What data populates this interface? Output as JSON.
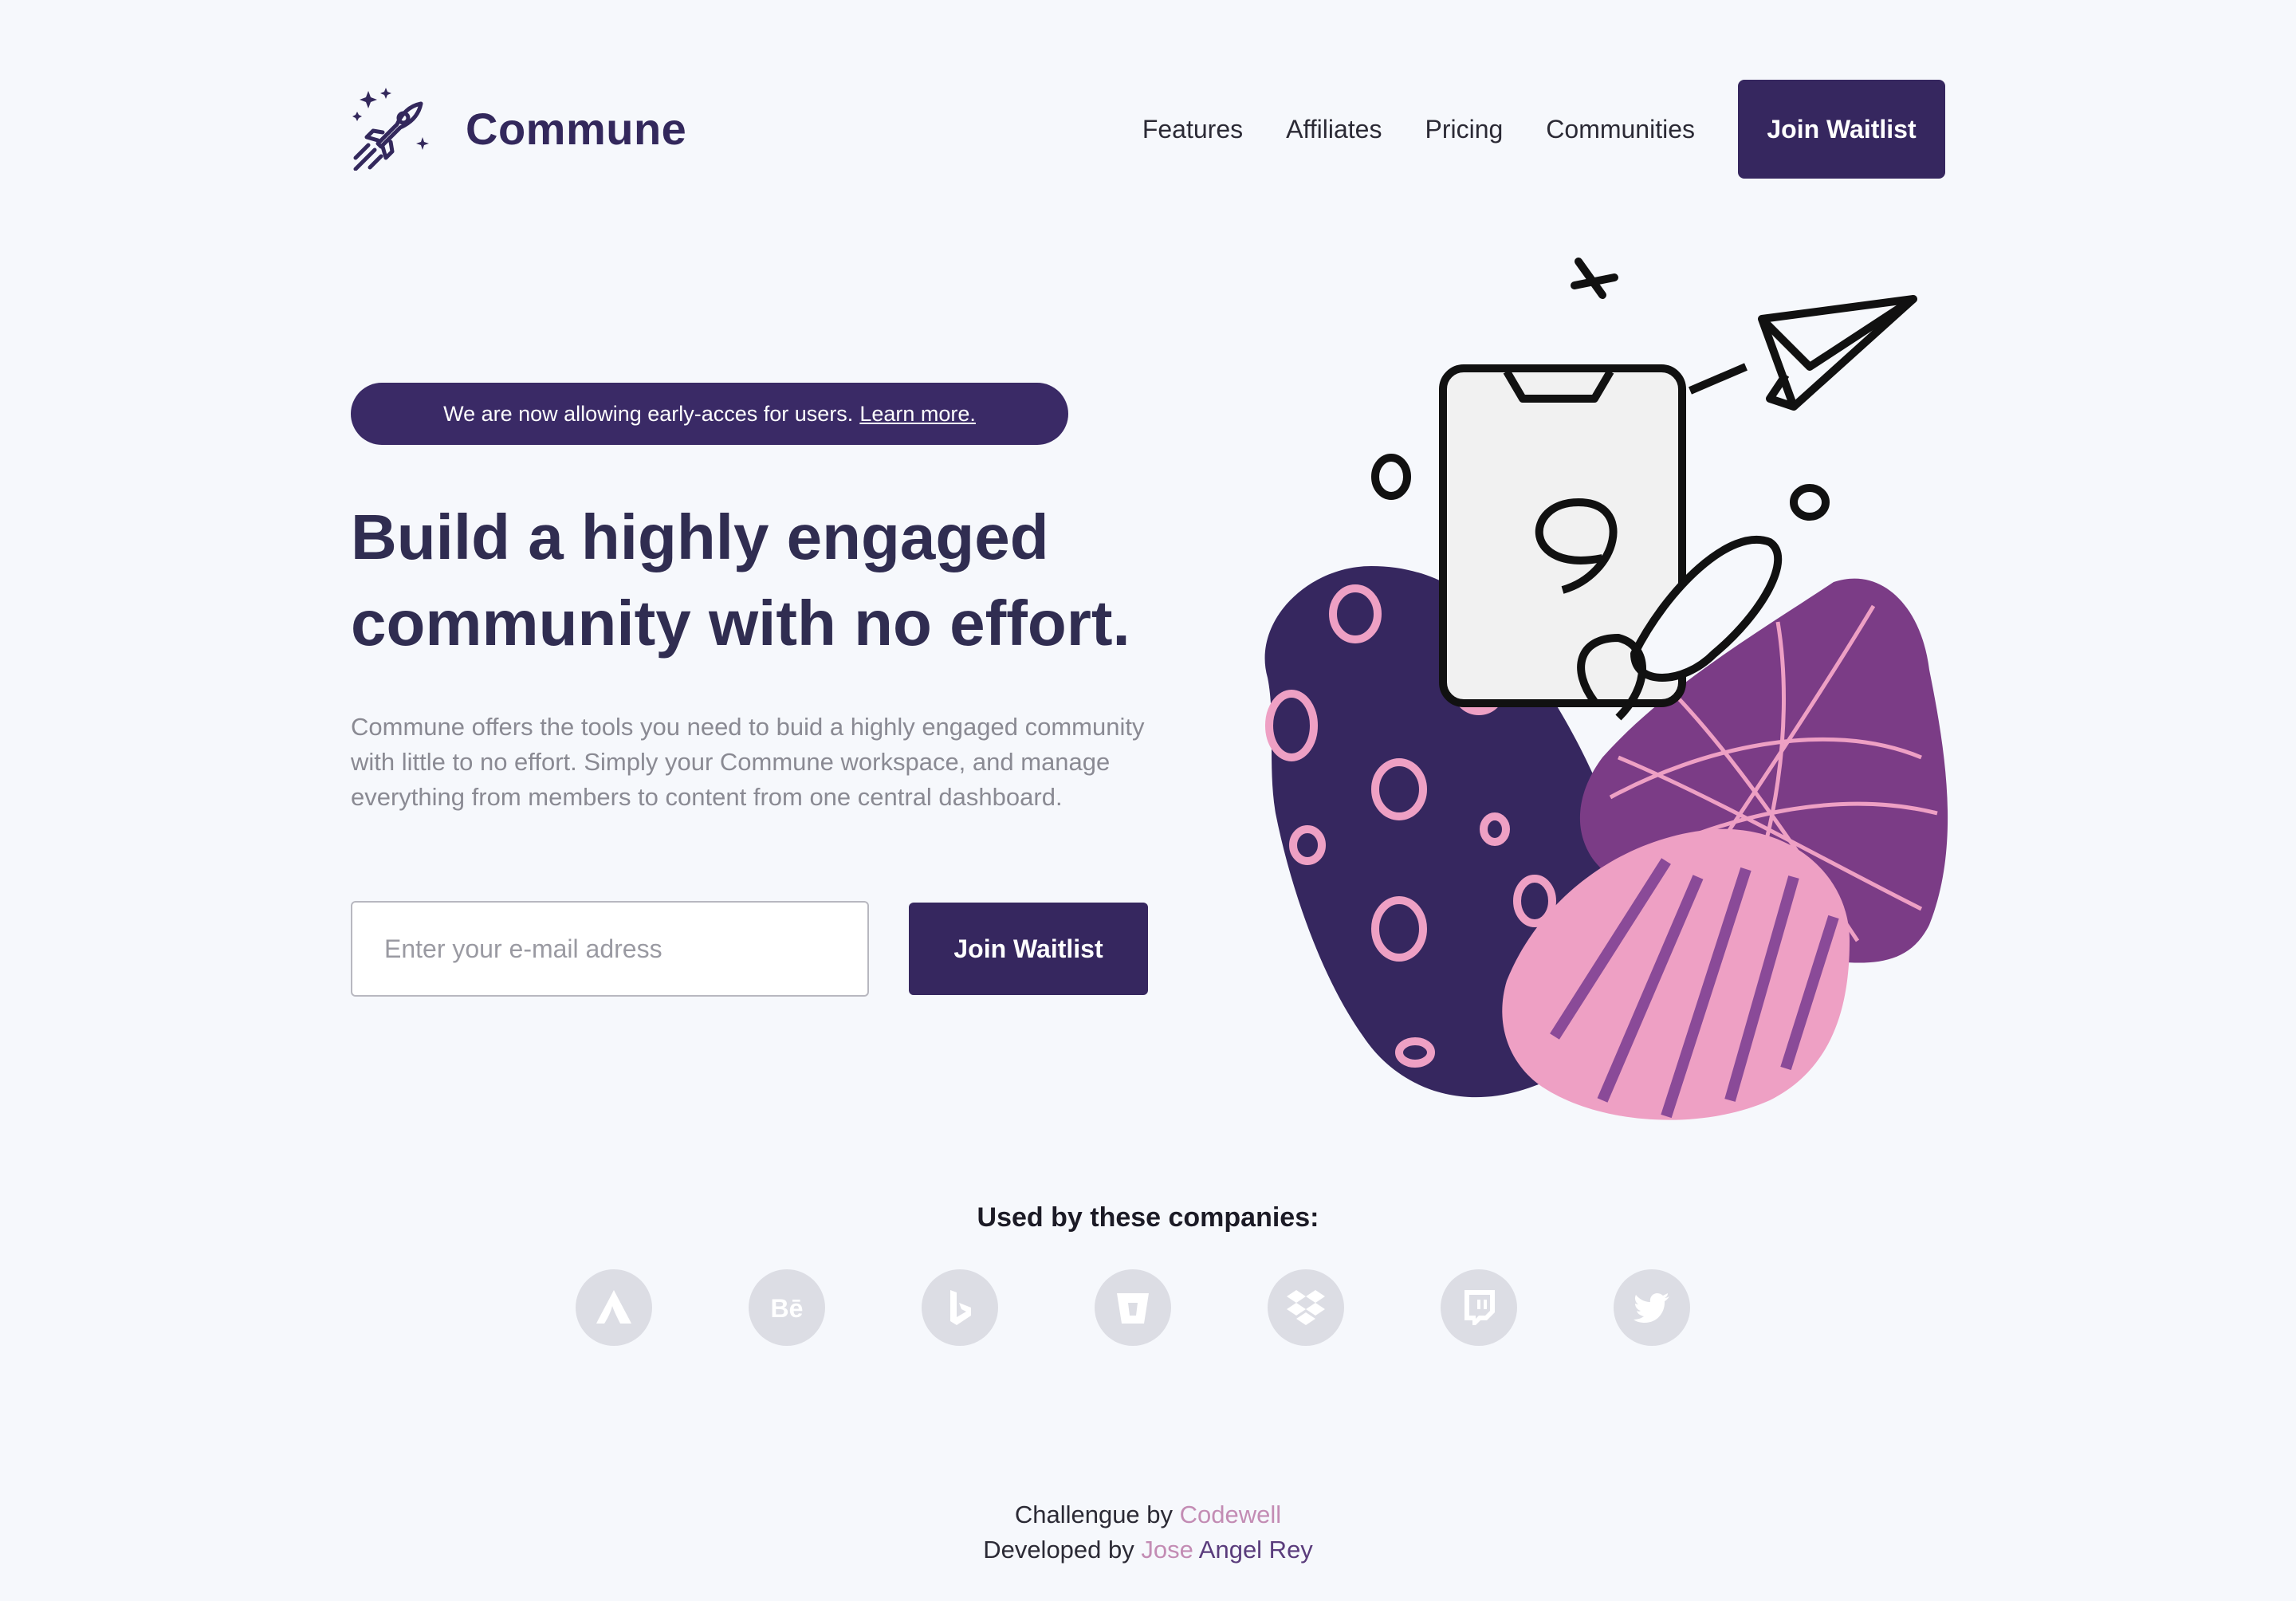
{
  "header": {
    "brand": "Commune",
    "nav": [
      "Features",
      "Affiliates",
      "Pricing",
      "Communities"
    ],
    "cta": "Join Waitlist"
  },
  "hero": {
    "announcement": "We are now allowing early-acces for users.",
    "announcement_link": "Learn more.",
    "headline_line1": "Build a highly engaged",
    "headline_line2": "community with no effort.",
    "description": "Commune offers the tools you need to buid a highly engaged community with little to no effort. Simply your Commune workspace, and manage everything from members to content from one central dashboard.",
    "email_placeholder": "Enter your e-mail adress",
    "cta": "Join Waitlist"
  },
  "companies": {
    "title": "Used by these companies:",
    "logos": [
      "atlassian-icon",
      "behance-icon",
      "bing-icon",
      "bitbucket-icon",
      "dropbox-icon",
      "twitch-icon",
      "twitter-icon"
    ]
  },
  "footer": {
    "line1_prefix": "Challengue by",
    "line1_link": "Codewell",
    "line2_prefix": "Developed by",
    "line2_link_first": "Jose",
    "line2_link_rest": "Angel Rey"
  },
  "colors": {
    "background": "#f6f8fc",
    "primary": "#36275f",
    "accent_pink": "#c38cb4",
    "illustration_purple": "#7b3c86",
    "illustration_pink": "#ee9ec3",
    "logo_gray": "#dcdde4"
  }
}
